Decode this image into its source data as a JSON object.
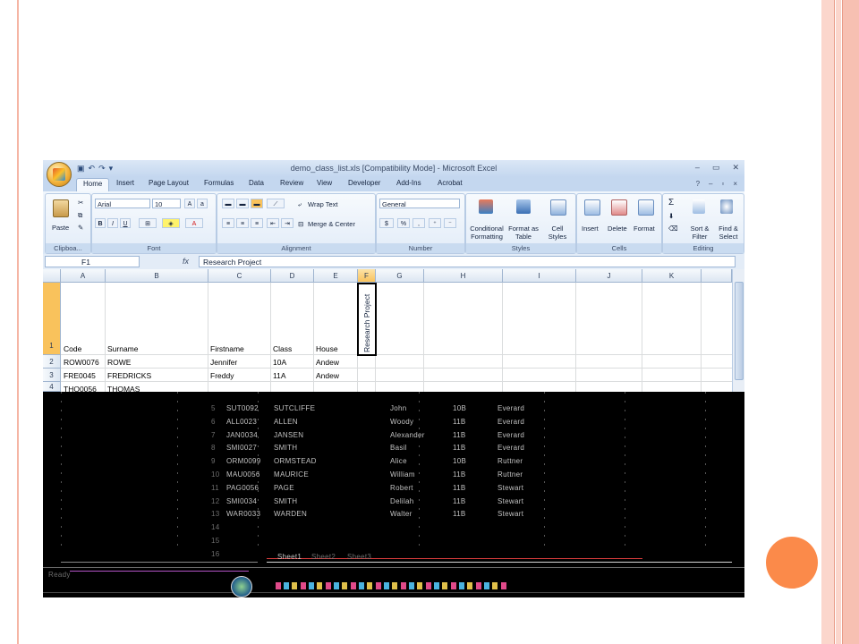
{
  "window": {
    "title": "demo_class_list.xls  [Compatibility Mode] - Microsoft Excel",
    "controls": [
      "–",
      "▭",
      "✕"
    ]
  },
  "ribbon": {
    "tabs": [
      "Home",
      "Insert",
      "Page Layout",
      "Formulas",
      "Data",
      "Review",
      "View",
      "Developer",
      "Add-Ins",
      "Acrobat"
    ],
    "active_tab": "Home",
    "clipboard": {
      "paste": "Paste",
      "label": "Clipboa..."
    },
    "font": {
      "name": "Arial",
      "size": "10",
      "label": "Font",
      "bold": "B",
      "italic": "I",
      "underline": "U"
    },
    "alignment": {
      "wrap_text": "Wrap Text",
      "merge": "Merge & Center",
      "label": "Alignment"
    },
    "number": {
      "format": "General",
      "currency": "$",
      "percent": "%",
      "comma": ",",
      "label": "Number"
    },
    "styles": {
      "conditional": "Conditional Formatting",
      "format_table": "Format as Table",
      "cell_styles": "Cell Styles",
      "label": "Styles"
    },
    "cells": {
      "insert": "Insert",
      "delete": "Delete",
      "format": "Format",
      "label": "Cells"
    },
    "editing": {
      "sort_filter": "Sort & Filter",
      "find_select": "Find & Select",
      "label": "Editing",
      "sigma": "Σ"
    }
  },
  "formula_bar": {
    "name_box": "F1",
    "fx": "fx",
    "content": "Research Project"
  },
  "sheet": {
    "columns": [
      "A",
      "B",
      "C",
      "D",
      "E",
      "F",
      "G",
      "H",
      "I",
      "J",
      "K"
    ],
    "selected_column": "F",
    "rows": [
      {
        "num": "1",
        "code": "Code",
        "surname": "Surname",
        "firstname": "Firstname",
        "class": "Class",
        "house": "House",
        "f": "Research Project"
      },
      {
        "num": "2",
        "code": "ROW0076",
        "surname": "ROWE",
        "firstname": "Jennifer",
        "class": "10A",
        "house": "Andew"
      },
      {
        "num": "3",
        "code": "FRE0045",
        "surname": "FREDRICKS",
        "firstname": "Freddy",
        "class": "11A",
        "house": "Andew"
      }
    ],
    "partial_row": {
      "num": "4",
      "code": "THO0056",
      "surname": "THOMAS"
    }
  },
  "corrupted_rows": [
    {
      "num": "5",
      "code": "SUT0092",
      "surname": "SUTCLIFFE",
      "firstname": "John",
      "class": "10B",
      "house": "Everard"
    },
    {
      "num": "6",
      "code": "ALL0023",
      "surname": "ALLEN",
      "firstname": "Woody",
      "class": "11B",
      "house": "Everard"
    },
    {
      "num": "7",
      "code": "JAN0034",
      "surname": "JANSEN",
      "firstname": "Alexander",
      "class": "11B",
      "house": "Everard"
    },
    {
      "num": "8",
      "code": "SMI0027",
      "surname": "SMITH",
      "firstname": "Basil",
      "class": "11B",
      "house": "Everard"
    },
    {
      "num": "9",
      "code": "ORM0099",
      "surname": "ORMSTEAD",
      "firstname": "Alice",
      "class": "10B",
      "house": "Ruttner"
    },
    {
      "num": "10",
      "code": "MAU0056",
      "surname": "MAURICE",
      "firstname": "William",
      "class": "11B",
      "house": "Ruttner"
    },
    {
      "num": "11",
      "code": "PAG0056",
      "surname": "PAGE",
      "firstname": "Robert",
      "class": "11B",
      "house": "Stewart"
    },
    {
      "num": "12",
      "code": "SMI0034",
      "surname": "SMITH",
      "firstname": "Delilah",
      "class": "11B",
      "house": "Stewart"
    },
    {
      "num": "13",
      "code": "WAR0033",
      "surname": "WARDEN",
      "firstname": "Walter",
      "class": "11B",
      "house": "Stewart"
    },
    {
      "num": "14"
    },
    {
      "num": "15"
    },
    {
      "num": "16"
    }
  ],
  "sheet_tabs": [
    "Sheet1",
    "Sheet2",
    "Sheet3"
  ],
  "status": {
    "ready": "Ready"
  },
  "colors": {
    "accent_circle": "#fb8a4a",
    "frame": "#fbd6cc",
    "ribbon": "#dce8f6",
    "selected_header": "#f9c25c"
  }
}
